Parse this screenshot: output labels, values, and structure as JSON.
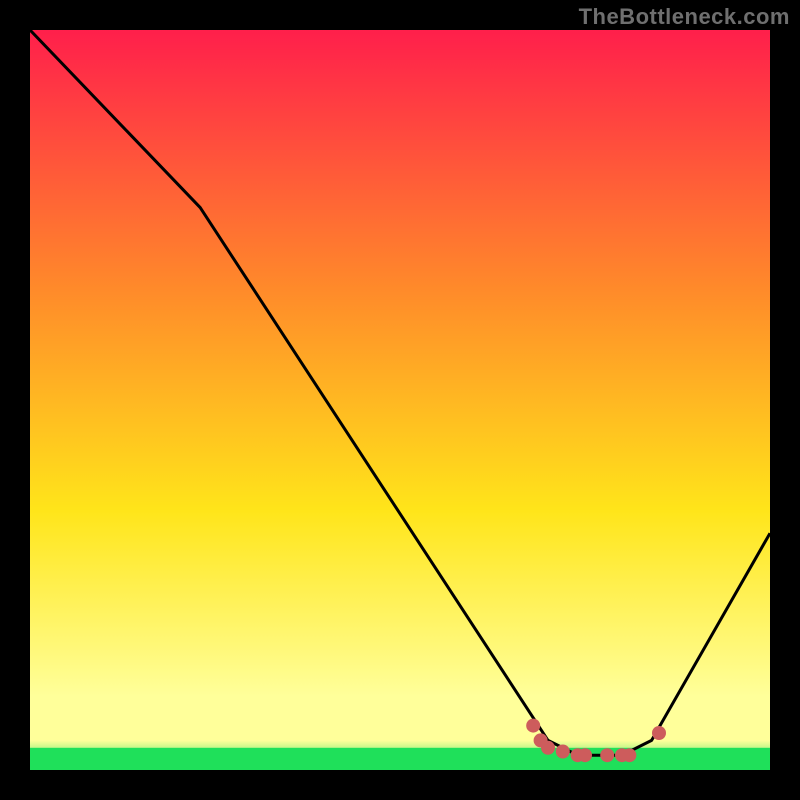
{
  "watermark": "TheBottleneck.com",
  "chart_data": {
    "type": "line",
    "title": "",
    "xlabel": "",
    "ylabel": "",
    "xlim": [
      0,
      100
    ],
    "ylim": [
      0,
      100
    ],
    "background_gradient": {
      "top": "#ff1f4b",
      "mid1": "#ff8a2a",
      "mid2": "#ffe51a",
      "bottom_band": "#ffff9a",
      "baseline": "#1fe05a"
    },
    "curve": {
      "name": "bottleneck-curve",
      "stroke": "#000000",
      "points": [
        {
          "x": 0,
          "y": 100
        },
        {
          "x": 23,
          "y": 76
        },
        {
          "x": 70,
          "y": 4
        },
        {
          "x": 74,
          "y": 2
        },
        {
          "x": 80,
          "y": 2
        },
        {
          "x": 84,
          "y": 4
        },
        {
          "x": 100,
          "y": 32
        }
      ]
    },
    "markers": {
      "name": "highlight-markers",
      "color": "#cd5c5c",
      "points": [
        {
          "x": 68,
          "y": 6
        },
        {
          "x": 69,
          "y": 4
        },
        {
          "x": 70,
          "y": 3
        },
        {
          "x": 72,
          "y": 2.5
        },
        {
          "x": 74,
          "y": 2
        },
        {
          "x": 75,
          "y": 2
        },
        {
          "x": 78,
          "y": 2
        },
        {
          "x": 80,
          "y": 2
        },
        {
          "x": 81,
          "y": 2
        },
        {
          "x": 85,
          "y": 5
        }
      ]
    }
  }
}
